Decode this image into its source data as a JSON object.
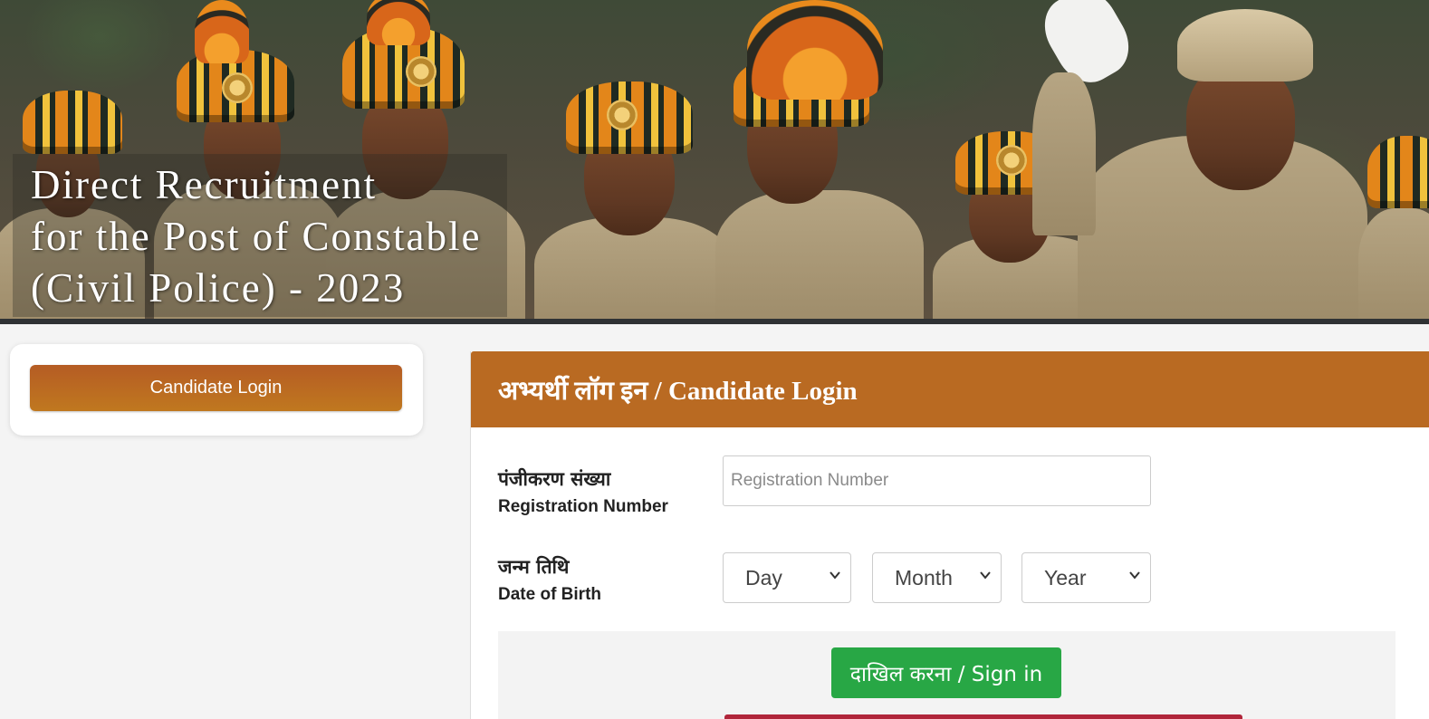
{
  "banner": {
    "title_lines": [
      "Direct Recruitment",
      "for the Post of Constable",
      "(Civil Police) - 2023"
    ]
  },
  "sidebar": {
    "login_button_label": "Candidate Login"
  },
  "login_panel": {
    "heading": "अभ्यर्थी लॉग इन / Candidate Login",
    "registration": {
      "label_hi": "पंजीकरण संख्या",
      "label_en": "Registration Number",
      "placeholder": "Registration Number",
      "value": ""
    },
    "dob": {
      "label_hi": "जन्म तिथि",
      "label_en": "Date of Birth",
      "day": "Day",
      "month": "Month",
      "year": "Year"
    },
    "signin_label": "दाखिल करना / Sign in"
  },
  "colors": {
    "header_brown": "#b96a22",
    "sidebar_button": "#b55c24",
    "signin_green": "#28a745",
    "background": "#f4f4f4"
  }
}
